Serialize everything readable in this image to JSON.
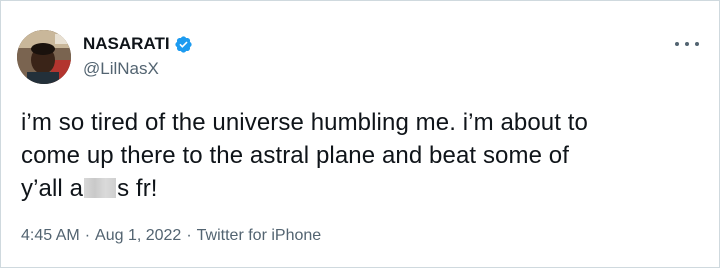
{
  "tweet": {
    "display_name": "NASARATI",
    "verified": true,
    "handle": "@LilNasX",
    "more_icon": "more-horizontal-icon",
    "text_line1": "i’m so tired of the universe humbling me. i’m about to",
    "text_line2": "come up there to the astral plane and beat some of",
    "text_line3_start": "y’all a",
    "text_line3_end": "s fr!",
    "time": "4:45 AM",
    "date": "Aug 1, 2022",
    "source": "Twitter for iPhone",
    "separator": "·"
  },
  "colors": {
    "text": "#0f1419",
    "secondary": "#536471",
    "verified_blue": "#1d9bf0",
    "border": "#cfd9de"
  }
}
